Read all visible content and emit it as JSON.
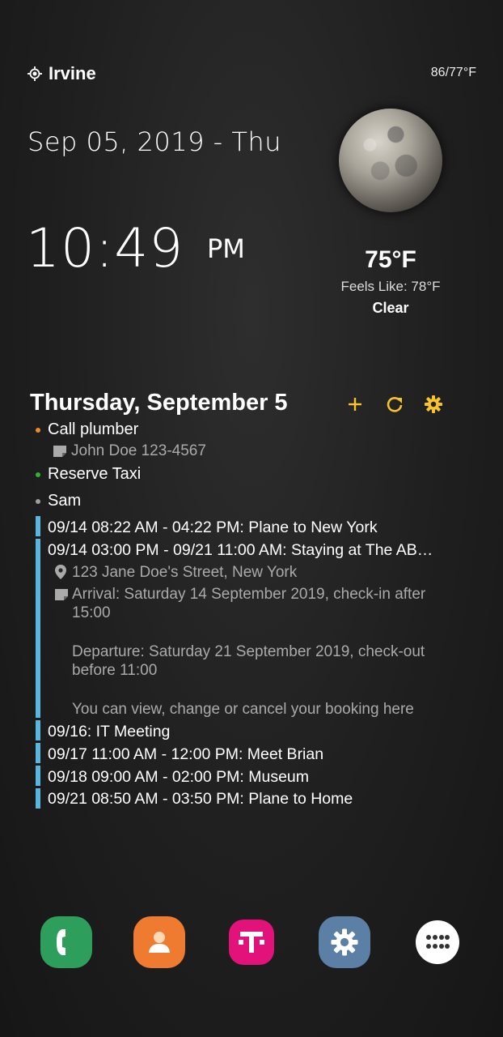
{
  "weather": {
    "location": "Irvine",
    "hi_lo": "86/77°F",
    "temperature": "75°F",
    "feels_like": "Feels Like: 78°F",
    "condition": "Clear"
  },
  "clock": {
    "date": "Sep 05, 2019 - Thu",
    "time": "10:49",
    "ampm": "PM"
  },
  "agenda": {
    "title": "Thursday, September 5",
    "tasks": [
      {
        "label": "Call plumber",
        "color": "#f08a24",
        "note": "John Doe 123-4567"
      },
      {
        "label": "Reserve Taxi",
        "color": "#2fb52f"
      },
      {
        "label": "Sam",
        "color": "#9e9e9e"
      }
    ],
    "events": [
      {
        "text": "09/14 08:22 AM - 04:22 PM: Plane to New York"
      },
      {
        "text": "09/14 03:00 PM - 09/21 11:00 AM: Staying at The AB…",
        "location": "123 Jane Doe's Street, New York",
        "notes": [
          "Arrival: Saturday 14 September 2019, check-in after",
          "15:00",
          "Departure: Saturday 21 September 2019, check-out",
          "before 11:00",
          "You can view, change or cancel your booking here"
        ]
      },
      {
        "text": "09/16: IT Meeting"
      },
      {
        "text": "09/17 11:00 AM - 12:00 PM: Meet Brian"
      },
      {
        "text": "09/18 09:00 AM - 02:00 PM: Museum"
      },
      {
        "text": "09/21 08:50 AM - 03:50 PM: Plane to Home"
      }
    ],
    "accent": "#f7c22b",
    "event_bar_color": "#5ab6dd"
  },
  "dock": [
    {
      "name": "phone-icon"
    },
    {
      "name": "contacts-icon"
    },
    {
      "name": "t-mobile-icon"
    },
    {
      "name": "settings-icon"
    },
    {
      "name": "app-drawer-icon"
    }
  ]
}
